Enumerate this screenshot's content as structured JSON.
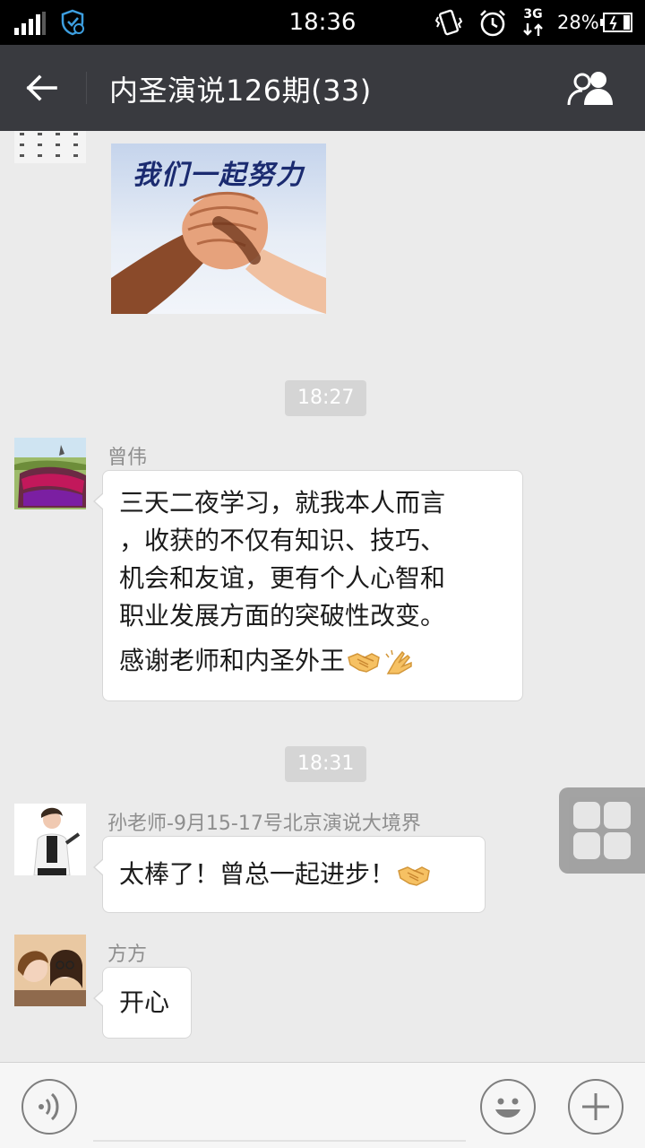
{
  "status_bar": {
    "time": "18:36",
    "network_type": "3G",
    "battery_percent": "28%",
    "icons": [
      "signal-icon",
      "shield-icon",
      "vibrate-icon",
      "alarm-icon",
      "network-3g-icon",
      "battery-icon"
    ]
  },
  "header": {
    "title": "内圣演说126期(33)",
    "back_icon": "arrow-left-icon",
    "members_icon": "group-icon"
  },
  "chat": {
    "image_message": {
      "caption": "我们一起努力"
    },
    "messages": [
      {
        "time": "18:27",
        "sender": "曾伟",
        "lines": [
          "三天二夜学习，就我本人而言",
          "，收获的不仅有知识、技巧、",
          "机会和友谊，更有个人心智和",
          "职业发展方面的突破性改变。",
          "感谢老师和内圣外王"
        ],
        "emojis": [
          "handshake-emoji",
          "clap-emoji"
        ]
      },
      {
        "time": "18:31",
        "sender": "孙老师-9月15-17号北京演说大境界",
        "lines": [
          "太棒了！曾总一起进步！"
        ],
        "emojis": [
          "handshake-emoji"
        ]
      },
      {
        "sender": "方方",
        "lines": [
          "开心"
        ]
      }
    ]
  },
  "input_bar": {
    "value": "",
    "voice_icon": "voice-icon",
    "emoji_icon": "smiley-icon",
    "plus_icon": "plus-icon"
  },
  "colors": {
    "header_bg": "#393a3f",
    "chat_bg": "#ebebeb",
    "bubble_bg": "#ffffff",
    "time_chip_bg": "#d5d5d5"
  }
}
